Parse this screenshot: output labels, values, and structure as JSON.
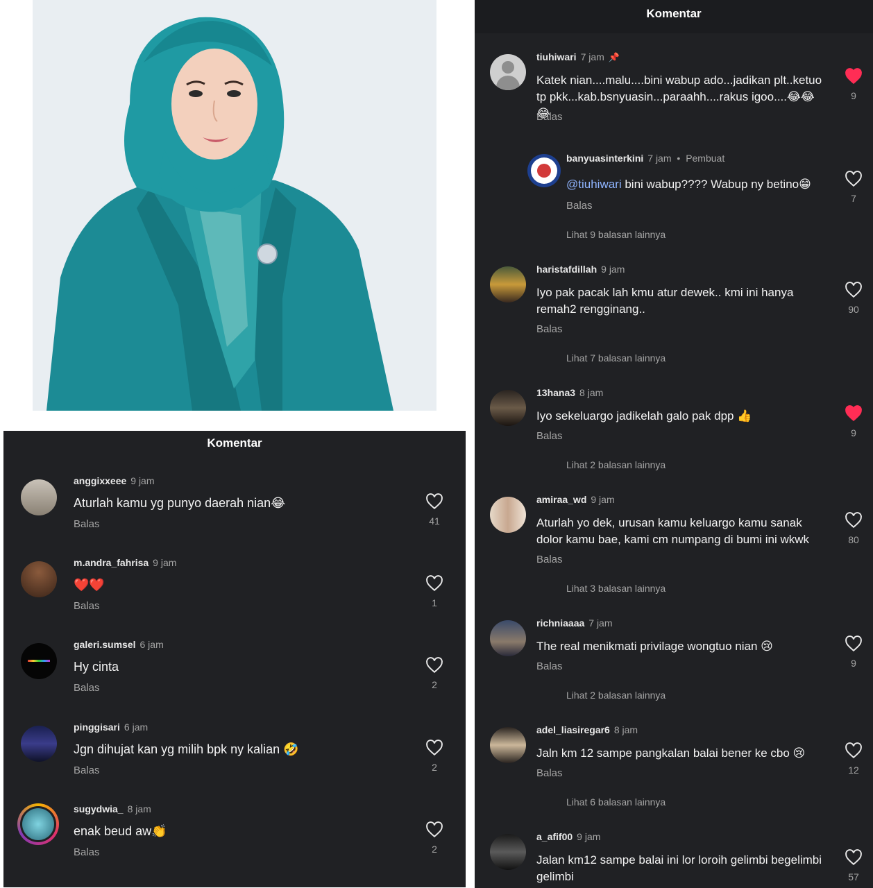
{
  "left_panel": {
    "title": "Komentar",
    "comments": [
      {
        "username": "anggixxeee",
        "time": "9 jam",
        "text": "Aturlah kamu yg punyo daerah nian😂",
        "reply": "Balas",
        "likes": "41",
        "liked": false
      },
      {
        "username": "m.andra_fahrisa",
        "time": "9 jam",
        "text": "❤️❤️",
        "reply": "Balas",
        "likes": "1",
        "liked": false
      },
      {
        "username": "galeri.sumsel",
        "time": "6 jam",
        "text": "Hy cinta",
        "reply": "Balas",
        "likes": "2",
        "liked": false
      },
      {
        "username": "pinggisari",
        "time": "6 jam",
        "text": "Jgn dihujat kan yg milih bpk ny kalian 🤣",
        "reply": "Balas",
        "likes": "2",
        "liked": false
      },
      {
        "username": "sugydwia_",
        "time": "8 jam",
        "text": "enak beud aw👏",
        "reply": "Balas",
        "likes": "2",
        "liked": false
      }
    ]
  },
  "right_panel": {
    "title": "Komentar",
    "comments": [
      {
        "username": "tiuhiwari",
        "time": "7 jam",
        "text": "Katek nian....malu....bini wabup ado...jadikan plt..ketuo tp pkk...kab.bsnyuasin...paraahh....rakus igoo....😂😂😂",
        "reply": "Balas",
        "likes": "9",
        "liked": true
      },
      {
        "username": "banyuasinterkini",
        "time": "7 jam",
        "creator": "Pembuat",
        "mention": "@tiuhiwari",
        "text": " bini wabup???? Wabup ny betino😁",
        "reply": "Balas",
        "likes": "7",
        "liked": false,
        "more": "Lihat 9 balasan lainnya"
      },
      {
        "username": "haristafdillah",
        "time": "9 jam",
        "text": "Iyo pak pacak lah kmu atur dewek.. kmi ini hanya remah2 rengginang..",
        "reply": "Balas",
        "likes": "90",
        "liked": false,
        "more": "Lihat 7 balasan lainnya"
      },
      {
        "username": "13hana3",
        "time": "8 jam",
        "text": "Iyo sekeluargo jadikelah galo pak dpp 👍",
        "reply": "Balas",
        "likes": "9",
        "liked": true,
        "more": "Lihat 2 balasan lainnya"
      },
      {
        "username": "amiraa_wd",
        "time": "9 jam",
        "text": "Aturlah yo dek, urusan kamu keluargo kamu sanak dolor kamu bae, kami cm numpang di bumi ini wkwk",
        "reply": "Balas",
        "likes": "80",
        "liked": false,
        "more": "Lihat 3 balasan lainnya"
      },
      {
        "username": "richniaaaa",
        "time": "7 jam",
        "text": "The real menikmati privilage wongtuo nian 😢",
        "reply": "Balas",
        "likes": "9",
        "liked": false,
        "more": "Lihat 2 balasan lainnya"
      },
      {
        "username": "adel_liasiregar6",
        "time": "8 jam",
        "text": "Jaln km 12 sampe pangkalan balai bener ke cbo 😢",
        "reply": "Balas",
        "likes": "12",
        "liked": false,
        "more": "Lihat 6 balasan lainnya"
      },
      {
        "username": "a_afif00",
        "time": "9 jam",
        "text": "Jalan km12 sampe balai ini lor loroih gelimbi begelimbi gelimbi",
        "likes": "57",
        "liked": false
      }
    ]
  },
  "colors": {
    "panel_bg": "#202124",
    "liked_heart": "#ff2d55",
    "teal_outfit": "#1d8d96"
  },
  "icons": {
    "pin": "pin-icon",
    "heart": "heart-icon",
    "heart_filled": "heart-filled-icon"
  }
}
